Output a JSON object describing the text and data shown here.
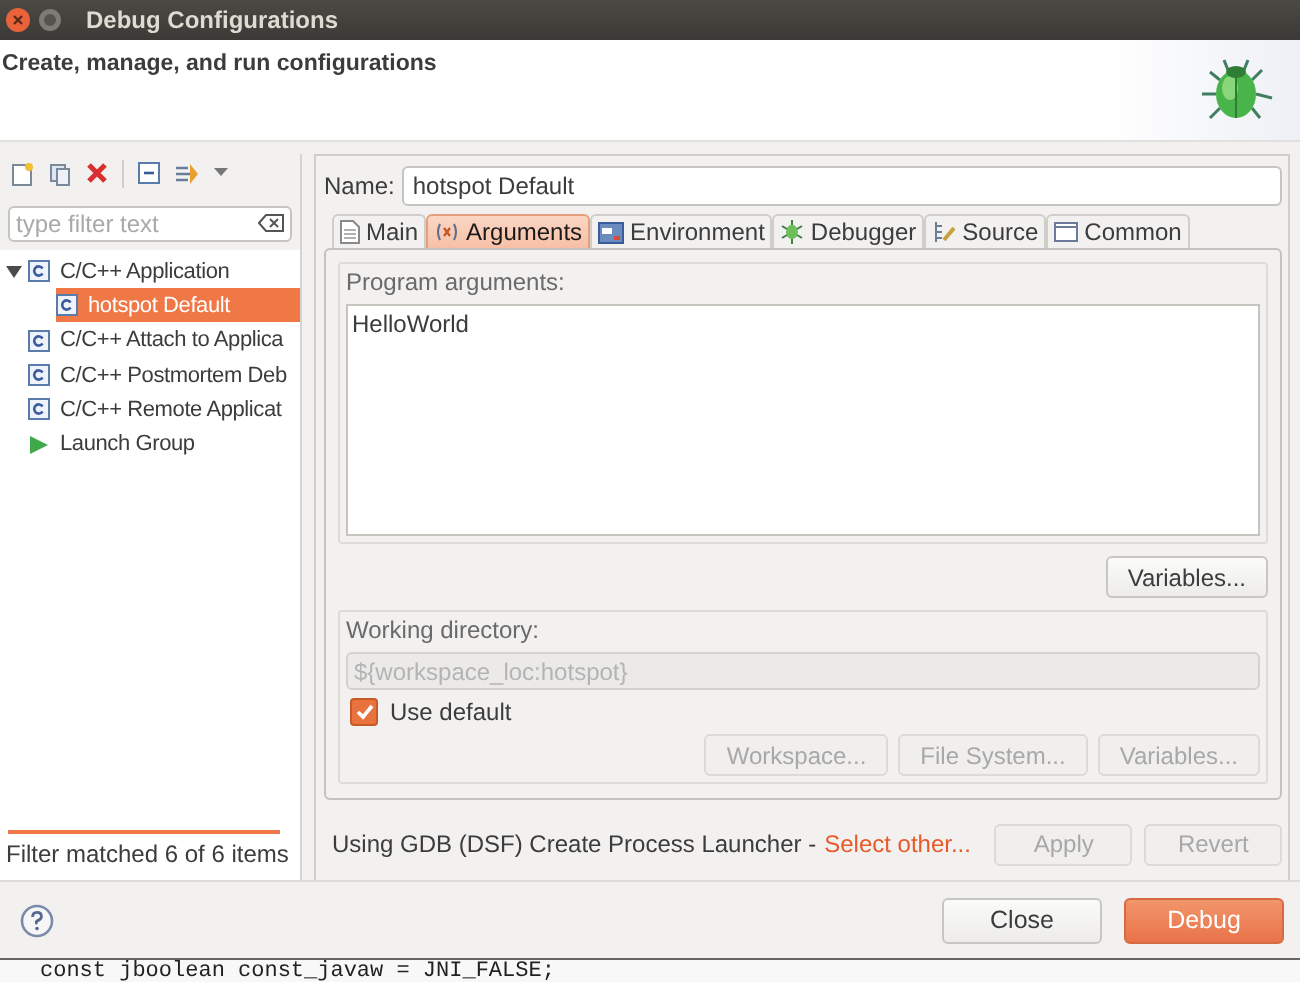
{
  "window": {
    "title": "Debug Configurations"
  },
  "header": {
    "message": "Create, manage, and run configurations"
  },
  "sidebar": {
    "filter": {
      "placeholder": "type filter text"
    },
    "tree": [
      {
        "label": "C/C++ Application",
        "kind": "c-config",
        "expanded": true,
        "selected": false,
        "children": [
          {
            "label": "hotspot Default",
            "kind": "c-config",
            "selected": true
          }
        ]
      },
      {
        "label": "C/C++ Attach to Applica",
        "kind": "c-config",
        "selected": false
      },
      {
        "label": "C/C++ Postmortem Deb",
        "kind": "c-config",
        "selected": false
      },
      {
        "label": "C/C++ Remote Applicat",
        "kind": "c-config",
        "selected": false
      },
      {
        "label": "Launch Group",
        "kind": "launch-group",
        "selected": false
      }
    ],
    "status": "Filter matched 6 of 6 items"
  },
  "editor": {
    "name_label": "Name:",
    "name": "hotspot Default",
    "tabs": [
      {
        "label": "Main",
        "kind": "main",
        "selected": false
      },
      {
        "label": "Arguments",
        "kind": "arguments",
        "selected": true
      },
      {
        "label": "Environment",
        "kind": "environment",
        "selected": false
      },
      {
        "label": "Debugger",
        "kind": "debugger",
        "selected": false
      },
      {
        "label": "Source",
        "kind": "source",
        "selected": false
      },
      {
        "label": "Common",
        "kind": "common",
        "selected": false
      }
    ],
    "program_arguments": {
      "label": "Program arguments:",
      "value": "HelloWorld",
      "variables_button": "Variables..."
    },
    "working_directory": {
      "label": "Working directory:",
      "value": "${workspace_loc:hotspot}",
      "disabled": true,
      "use_default": {
        "label": "Use default",
        "checked": true
      },
      "buttons": [
        {
          "label": "Workspace...",
          "disabled": true
        },
        {
          "label": "File System...",
          "disabled": true
        },
        {
          "label": "Variables...",
          "disabled": true
        }
      ]
    },
    "launcher": {
      "text": "Using GDB (DSF) Create Process Launcher -",
      "link": "Select other..."
    },
    "buttons": [
      {
        "label": "Apply",
        "disabled": true
      },
      {
        "label": "Revert",
        "disabled": true
      }
    ]
  },
  "buttonbar": [
    {
      "label": "Close",
      "kind": "normal"
    },
    {
      "label": "Debug",
      "kind": "default"
    }
  ],
  "background": {
    "code_line": "const jboolean const_javaw = JNI_FALSE;"
  }
}
